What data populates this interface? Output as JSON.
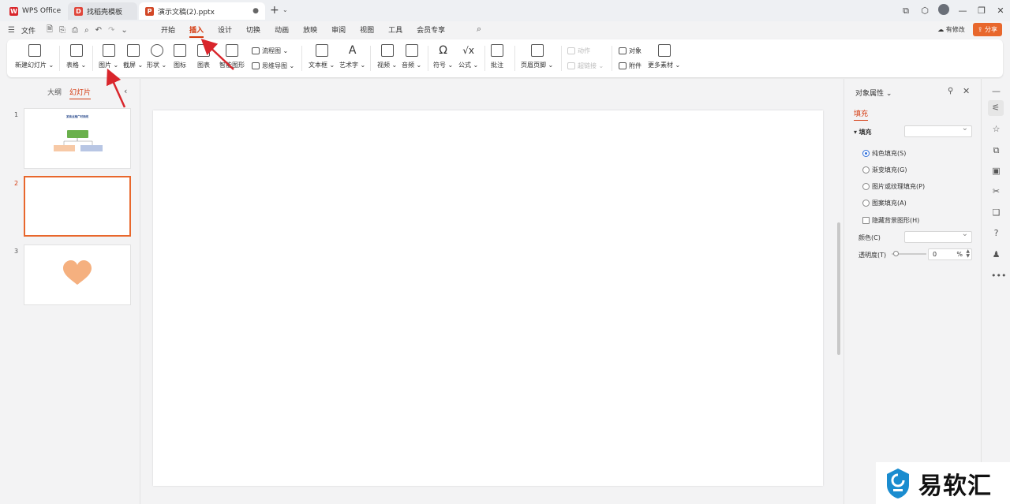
{
  "titlebar": {
    "tabs": [
      {
        "label": "WPS Office"
      },
      {
        "label": "找稻壳模板"
      },
      {
        "label": "演示文稿(2).pptx"
      }
    ]
  },
  "menubar": {
    "file": "文件",
    "tabs": [
      "开始",
      "插入",
      "设计",
      "切换",
      "动画",
      "放映",
      "审阅",
      "视图",
      "工具",
      "会员专享"
    ],
    "active_tab": "插入",
    "modify": "有修改",
    "share": "分享"
  },
  "ribbon": {
    "new_slide": "新建幻灯片",
    "table": "表格",
    "picture": "图片",
    "screenshot": "截屏",
    "shape": "形状",
    "icon": "图标",
    "chart": "图表",
    "smart_shape": "智能图形",
    "flowchart": "流程图",
    "mindmap": "思维导图",
    "textbox": "文本框",
    "wordart": "艺术字",
    "video": "视频",
    "audio": "音频",
    "symbol": "符号",
    "formula": "公式",
    "comment": "批注",
    "header_footer": "页眉页脚",
    "action": "动作",
    "hyperlink": "超链接",
    "object": "对象",
    "attachment": "附件",
    "more_materials": "更多素材"
  },
  "left_panel": {
    "tab_outline": "大纲",
    "tab_slides": "幻灯片",
    "slide_numbers": [
      "1",
      "2",
      "3"
    ],
    "slide1_title": "某商业推广时间线"
  },
  "right_panel": {
    "title": "对象属性",
    "subtab": "填充",
    "fill_label": "填充",
    "options": [
      "纯色填充(S)",
      "渐变填充(G)",
      "图片或纹理填充(P)",
      "图案填充(A)"
    ],
    "hide_bg": "隐藏背景图形(H)",
    "color_label": "颜色(C)",
    "transparency_label": "透明度(T)",
    "transparency_value": "0",
    "percent": "%"
  },
  "watermark": {
    "text": "易软汇"
  },
  "colors": {
    "accent": "#d4380d",
    "share": "#e8672c",
    "heart": "#f5b07f",
    "arrow": "#d9262c"
  }
}
